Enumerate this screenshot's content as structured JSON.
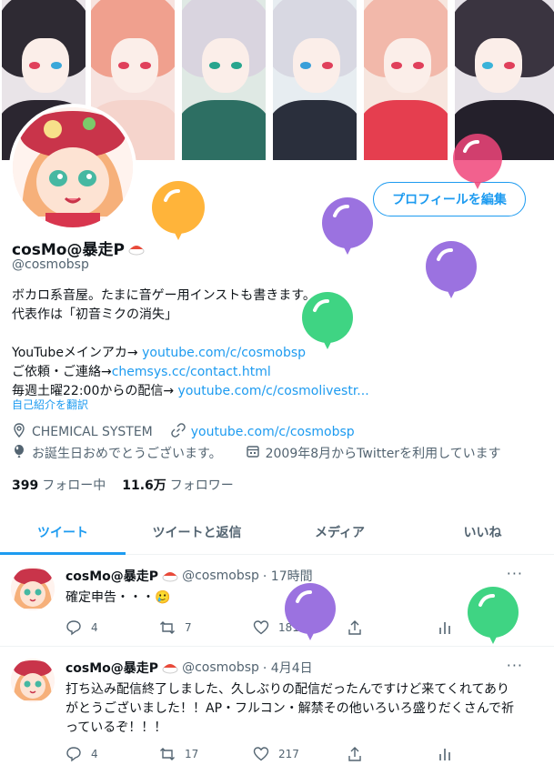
{
  "profile": {
    "name": "cosMo@暴走P",
    "handle": "@cosmobsp",
    "edit_button": "プロフィールを編集",
    "bio": {
      "line1": "ボカロ系音屋。たまに音ゲー用インストも書きます。",
      "line2": "代表作は「初音ミクの消失」",
      "youtube_label": "YouTubeメインアカ→ ",
      "youtube_link": "youtube.com/c/cosmobsp",
      "contact_label": "ご依頼・ご連絡→",
      "contact_link": "chemsys.cc/contact.html",
      "stream_label": "毎週土曜22:00からの配信→ ",
      "stream_link": "youtube.com/c/cosmolivestr..."
    },
    "translate": "自己紹介を翻訳",
    "location": "CHEMICAL SYSTEM",
    "website": "youtube.com/c/cosmobsp",
    "birthday": "お誕生日おめでとうございます。",
    "joined": "2009年8月からTwitterを利用しています",
    "following_count": "399",
    "following_label": "フォロー中",
    "followers_count": "11.6万",
    "followers_label": "フォロワー"
  },
  "tabs": [
    "ツイート",
    "ツイートと返信",
    "メディア",
    "いいね"
  ],
  "tweets": [
    {
      "name": "cosMo@暴走P",
      "handle": "@cosmobsp",
      "time": "· 17時間",
      "text": "確定申告・・・🥲",
      "replies": "4",
      "retweets": "7",
      "likes": "181"
    },
    {
      "name": "cosMo@暴走P",
      "handle": "@cosmobsp",
      "time": "· 4月4日",
      "text": "打ち込み配信終了しました、久しぶりの配信だったんですけど来てくれてありがとうございました！！AP・フルコン・解禁その他いろいろ盛りだくさんで祈っているぞ！！！",
      "replies": "4",
      "retweets": "17",
      "likes": "217"
    }
  ],
  "colors": {
    "accent": "#1d9bf0",
    "balloon_orange": "#ffb43a",
    "balloon_purple": "#9b72e0",
    "balloon_green": "#3fd483",
    "balloon_pink": "#f0457a"
  }
}
